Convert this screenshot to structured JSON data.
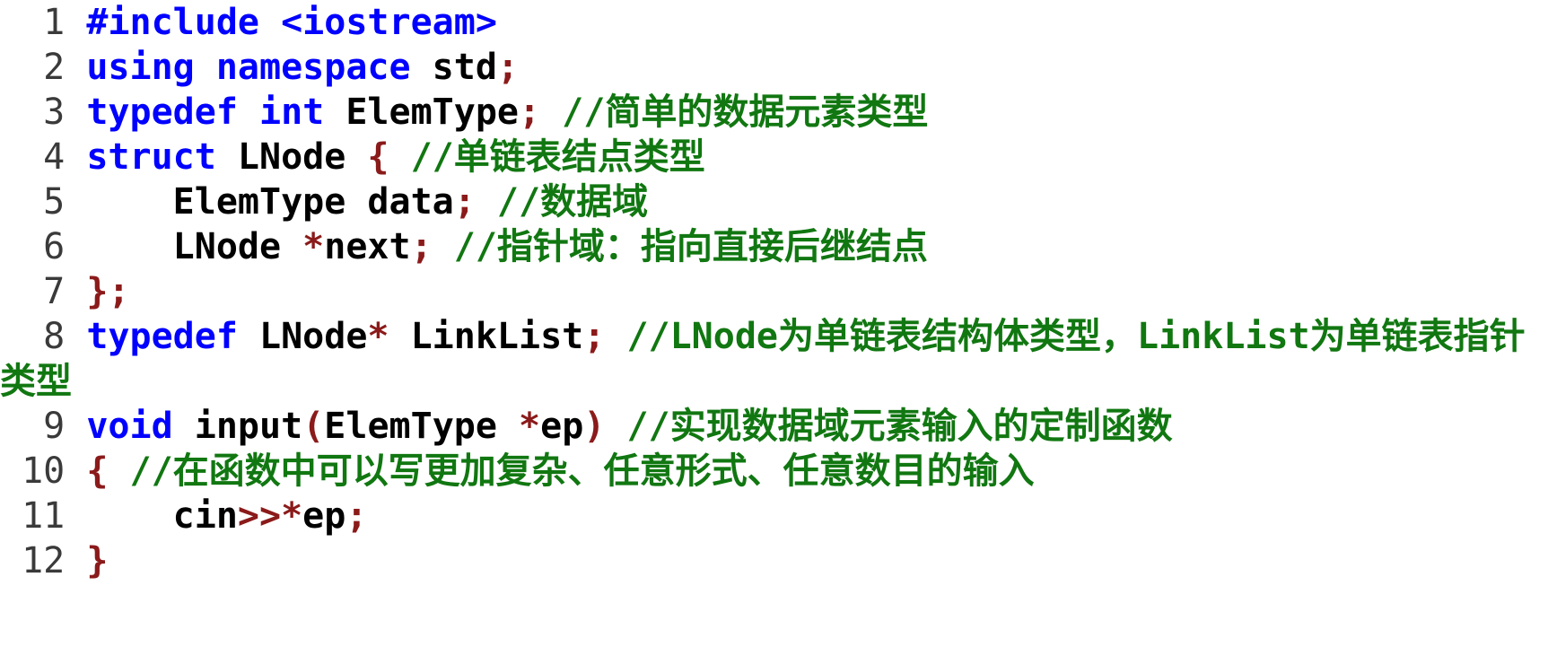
{
  "document": {
    "kind": "source-code-listing",
    "language": "C++",
    "background_color": "#ffffff",
    "font_size_px": 40,
    "line_height_px": 50,
    "theme": {
      "keyword_color": "#0000ff",
      "identifier_color": "#000000",
      "punctuation_color": "#8b1a1a",
      "comment_color": "#117711",
      "line_number_color": "#3a3a3a"
    },
    "line_number_width_chars": 3,
    "first_line_number": 1,
    "last_line_number": 12,
    "total_lines": 12
  },
  "code": {
    "lines": [
      {
        "number": "  1",
        "tokens": [
          {
            "text": "#include ",
            "type": "kw"
          },
          {
            "text": "<iostream>",
            "type": "kw"
          }
        ],
        "plain": "#include <iostream>"
      },
      {
        "number": "  2",
        "tokens": [
          {
            "text": "using namespace ",
            "type": "kw"
          },
          {
            "text": "std",
            "type": "id"
          },
          {
            "text": ";",
            "type": "punct"
          }
        ],
        "plain": "using namespace std;"
      },
      {
        "number": "  3",
        "tokens": [
          {
            "text": "typedef int ",
            "type": "kw"
          },
          {
            "text": "ElemType",
            "type": "id"
          },
          {
            "text": "; ",
            "type": "punct"
          },
          {
            "text": "//简单的数据元素类型",
            "type": "comment"
          }
        ],
        "plain": "typedef int ElemType; //简单的数据元素类型"
      },
      {
        "number": "  4",
        "tokens": [
          {
            "text": "struct ",
            "type": "kw"
          },
          {
            "text": "LNode ",
            "type": "id"
          },
          {
            "text": "{ ",
            "type": "punct"
          },
          {
            "text": "//单链表结点类型",
            "type": "comment"
          }
        ],
        "plain": "struct LNode { //单链表结点类型"
      },
      {
        "number": "  5",
        "tokens": [
          {
            "text": "    ElemType data",
            "type": "id"
          },
          {
            "text": "; ",
            "type": "punct"
          },
          {
            "text": "//数据域",
            "type": "comment"
          }
        ],
        "plain": "    ElemType data; //数据域"
      },
      {
        "number": "  6",
        "tokens": [
          {
            "text": "    LNode ",
            "type": "id"
          },
          {
            "text": "*",
            "type": "punct"
          },
          {
            "text": "next",
            "type": "id"
          },
          {
            "text": "; ",
            "type": "punct"
          },
          {
            "text": "//指针域：指向直接后继结点",
            "type": "comment"
          }
        ],
        "plain": "    LNode *next; //指针域：指向直接后继结点"
      },
      {
        "number": "  7",
        "tokens": [
          {
            "text": "};",
            "type": "punct"
          }
        ],
        "plain": "};"
      },
      {
        "number": "  8",
        "tokens": [
          {
            "text": "typedef ",
            "type": "kw"
          },
          {
            "text": "LNode",
            "type": "id"
          },
          {
            "text": "*",
            "type": "punct"
          },
          {
            "text": " LinkList",
            "type": "id"
          },
          {
            "text": "; ",
            "type": "punct"
          },
          {
            "text": "//LNode为单链表结构体类型，LinkList为单链表指针类型",
            "type": "comment"
          }
        ],
        "plain": "typedef LNode* LinkList; //LNode为单链表结构体类型，LinkList为单链表指针类型",
        "wraps": true
      },
      {
        "number": "  9",
        "tokens": [
          {
            "text": "void ",
            "type": "kw"
          },
          {
            "text": "input",
            "type": "id"
          },
          {
            "text": "(",
            "type": "punct"
          },
          {
            "text": "ElemType ",
            "type": "id"
          },
          {
            "text": "*",
            "type": "punct"
          },
          {
            "text": "ep",
            "type": "id"
          },
          {
            "text": ") ",
            "type": "punct"
          },
          {
            "text": "//实现数据域元素输入的定制函数",
            "type": "comment"
          }
        ],
        "plain": "void input(ElemType *ep) //实现数据域元素输入的定制函数"
      },
      {
        "number": " 10",
        "tokens": [
          {
            "text": "{ ",
            "type": "punct"
          },
          {
            "text": "//在函数中可以写更加复杂、任意形式、任意数目的输入",
            "type": "comment"
          }
        ],
        "plain": "{ //在函数中可以写更加复杂、任意形式、任意数目的输入"
      },
      {
        "number": " 11",
        "tokens": [
          {
            "text": "    cin",
            "type": "id"
          },
          {
            "text": ">>*",
            "type": "punct"
          },
          {
            "text": "ep",
            "type": "id"
          },
          {
            "text": ";",
            "type": "punct"
          }
        ],
        "plain": "    cin>>*ep;"
      },
      {
        "number": " 12",
        "tokens": [
          {
            "text": "}",
            "type": "punct"
          }
        ],
        "plain": "}"
      }
    ]
  }
}
